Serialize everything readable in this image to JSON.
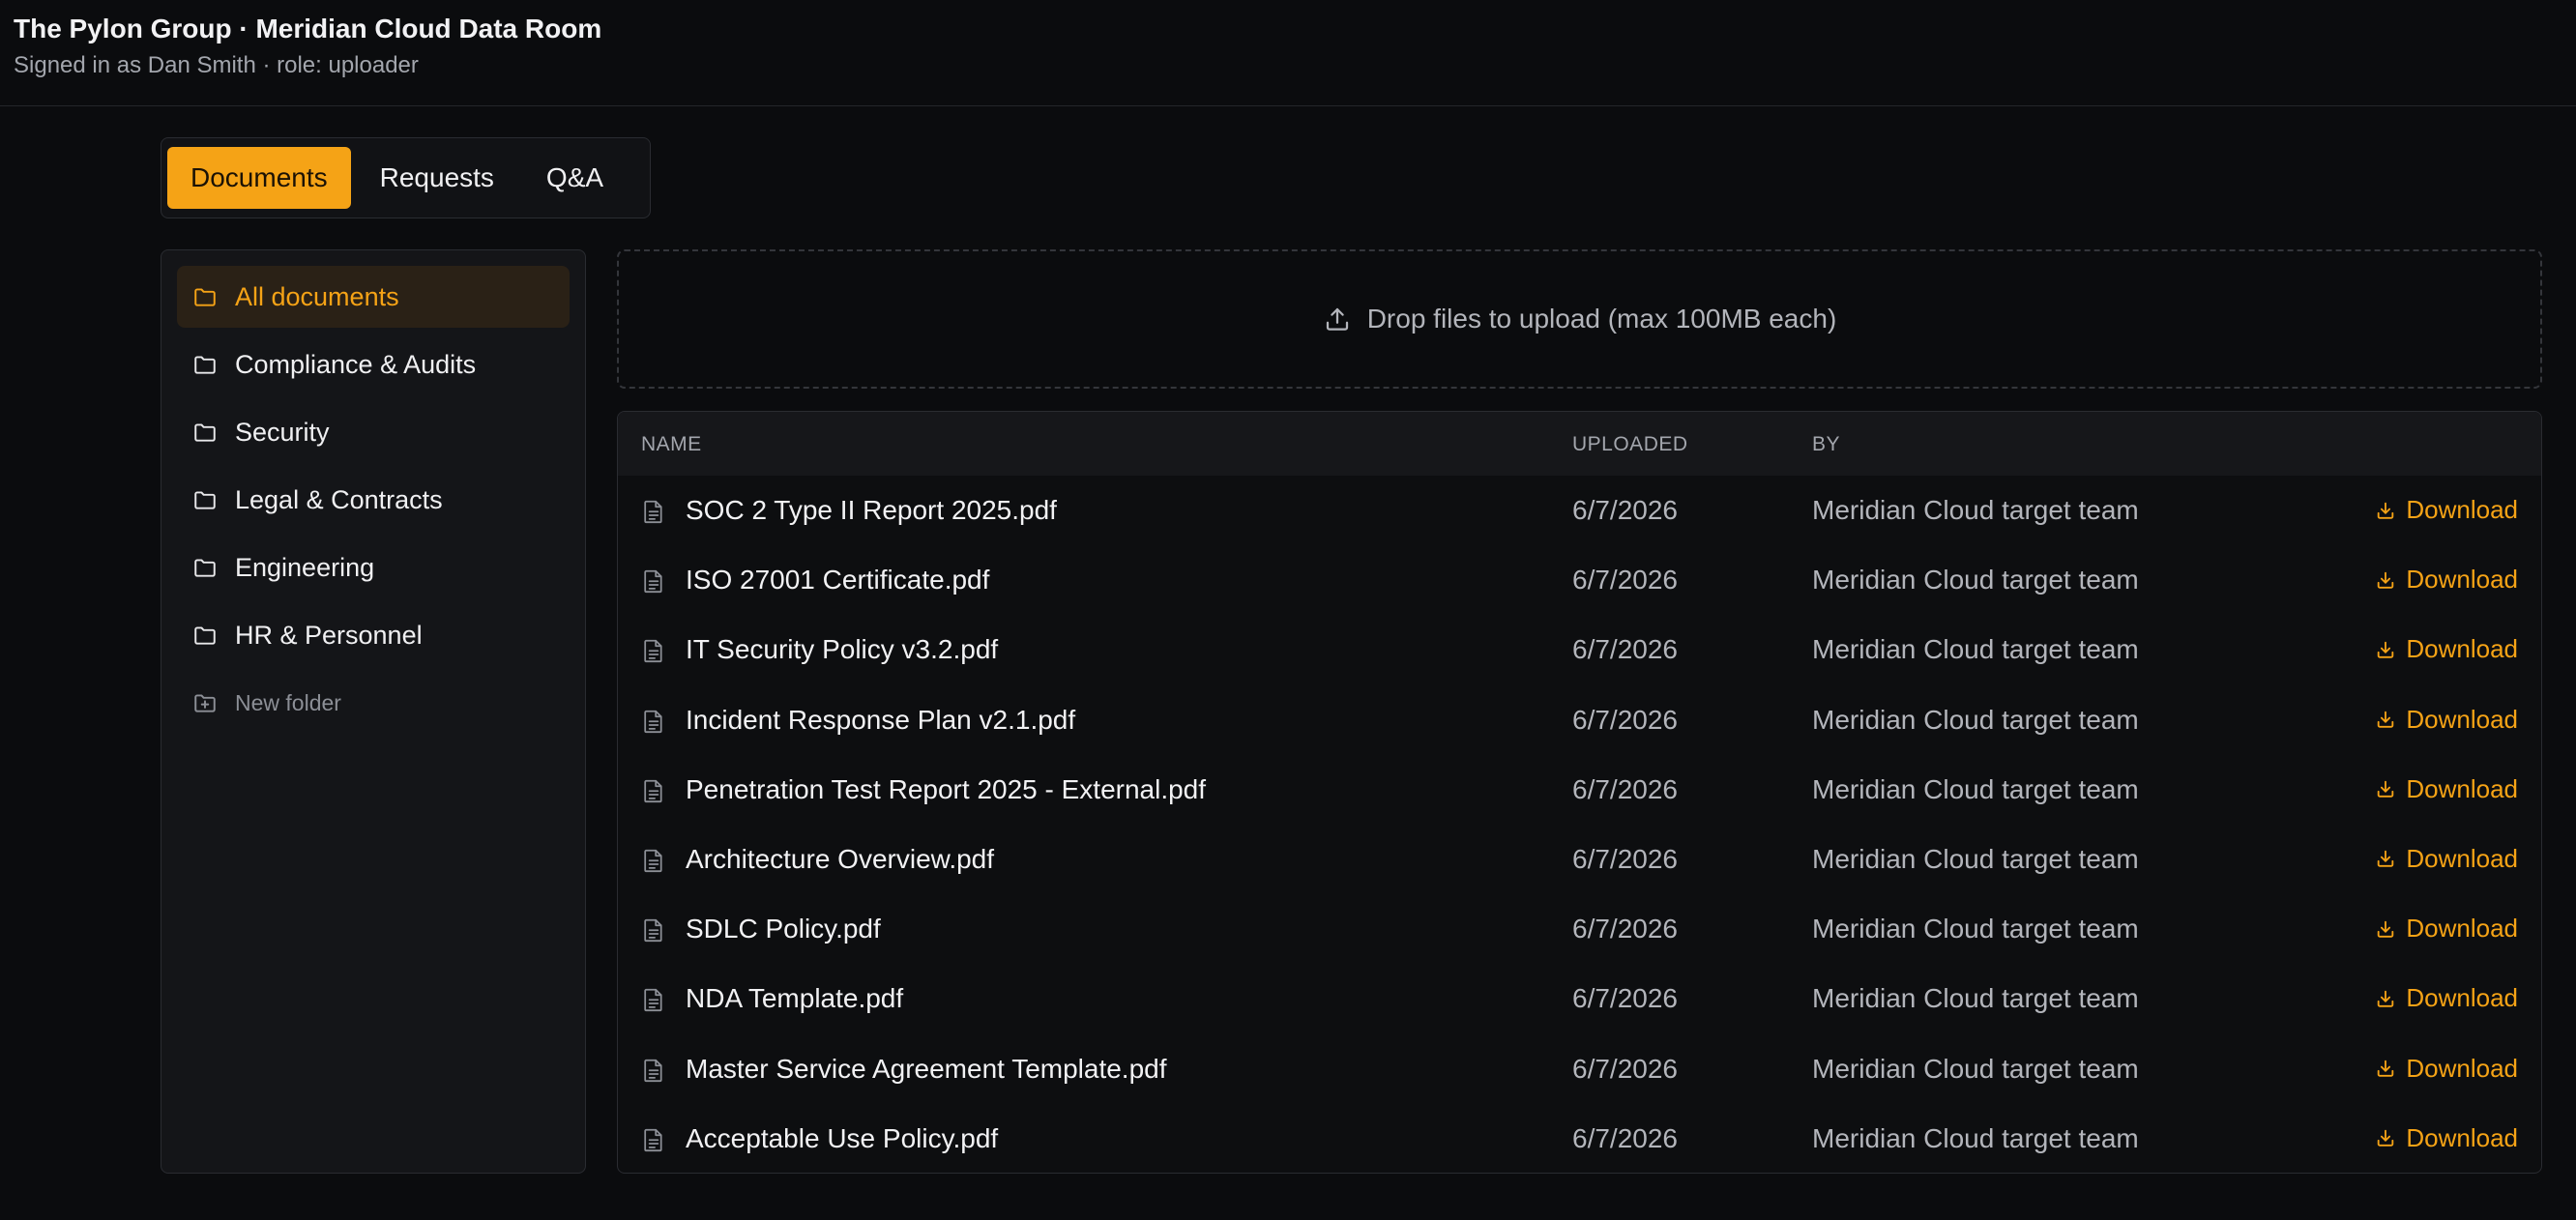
{
  "header": {
    "title": "The Pylon Group · Meridian Cloud Data Room",
    "subtitle": "Signed in as Dan Smith · role: uploader"
  },
  "tabs": [
    {
      "label": "Documents",
      "active": true
    },
    {
      "label": "Requests",
      "active": false
    },
    {
      "label": "Q&A",
      "active": false
    }
  ],
  "sidebar": {
    "folders": [
      {
        "label": "All documents",
        "active": true
      },
      {
        "label": "Compliance & Audits",
        "active": false
      },
      {
        "label": "Security",
        "active": false
      },
      {
        "label": "Legal & Contracts",
        "active": false
      },
      {
        "label": "Engineering",
        "active": false
      },
      {
        "label": "HR & Personnel",
        "active": false
      }
    ],
    "new_folder_label": "New folder"
  },
  "dropzone": {
    "label": "Drop files to upload (max 100MB each)"
  },
  "table": {
    "columns": {
      "name": "NAME",
      "uploaded": "UPLOADED",
      "by": "BY"
    },
    "download_label": "Download",
    "rows": [
      {
        "name": "SOC 2 Type II Report 2025.pdf",
        "uploaded": "6/7/2026",
        "by": "Meridian Cloud target team"
      },
      {
        "name": "ISO 27001 Certificate.pdf",
        "uploaded": "6/7/2026",
        "by": "Meridian Cloud target team"
      },
      {
        "name": "IT Security Policy v3.2.pdf",
        "uploaded": "6/7/2026",
        "by": "Meridian Cloud target team"
      },
      {
        "name": "Incident Response Plan v2.1.pdf",
        "uploaded": "6/7/2026",
        "by": "Meridian Cloud target team"
      },
      {
        "name": "Penetration Test Report 2025 - External.pdf",
        "uploaded": "6/7/2026",
        "by": "Meridian Cloud target team"
      },
      {
        "name": "Architecture Overview.pdf",
        "uploaded": "6/7/2026",
        "by": "Meridian Cloud target team"
      },
      {
        "name": "SDLC Policy.pdf",
        "uploaded": "6/7/2026",
        "by": "Meridian Cloud target team"
      },
      {
        "name": "NDA Template.pdf",
        "uploaded": "6/7/2026",
        "by": "Meridian Cloud target team"
      },
      {
        "name": "Master Service Agreement Template.pdf",
        "uploaded": "6/7/2026",
        "by": "Meridian Cloud target team"
      },
      {
        "name": "Acceptable Use Policy.pdf",
        "uploaded": "6/7/2026",
        "by": "Meridian Cloud target team"
      }
    ]
  },
  "colors": {
    "accent": "#f5a316",
    "background": "#0b0c0e",
    "panel": "#141518"
  },
  "icons": {
    "folder": "folder-icon",
    "new_folder": "folder-plus-icon",
    "upload": "upload-icon",
    "document": "file-text-icon",
    "download": "download-icon"
  }
}
